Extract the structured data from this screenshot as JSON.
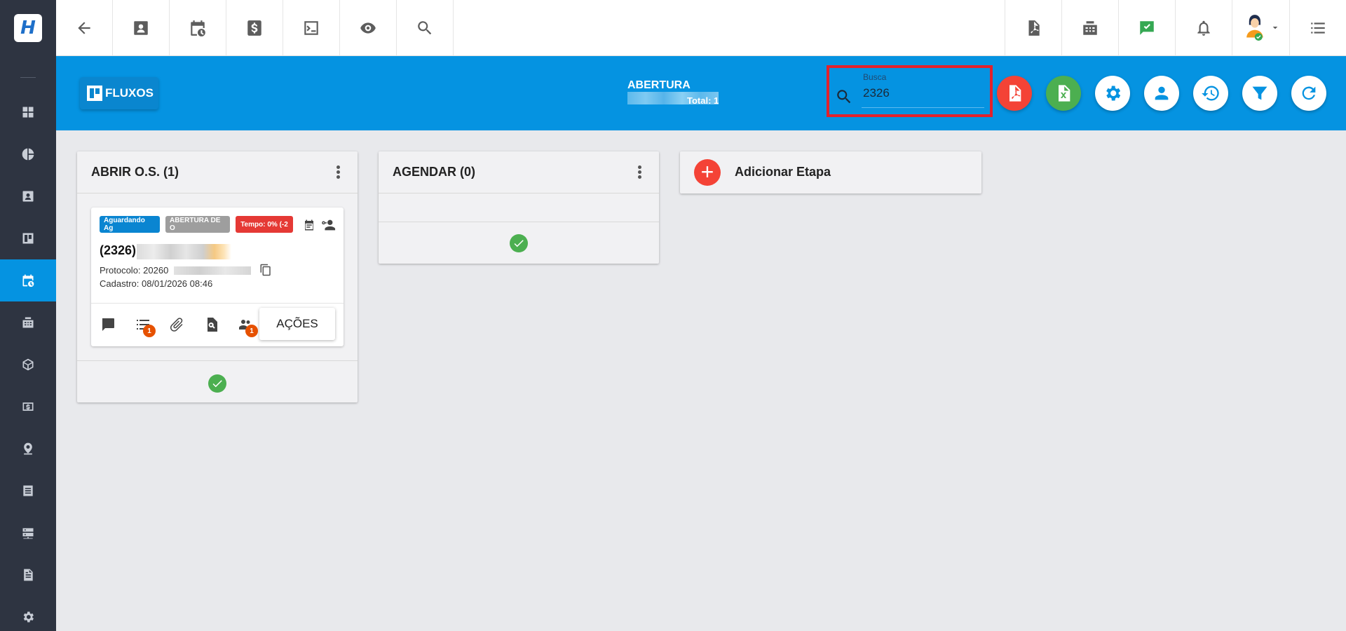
{
  "header": {
    "fluxos_label": "FLUXOS",
    "title": "ABERTURA",
    "total": "Total: 1",
    "search": {
      "label": "Busca",
      "value": "2326"
    }
  },
  "columns": [
    {
      "title": "ABRIR O.S. (1)",
      "card": {
        "tags": [
          "Aguardando Ag",
          "ABERTURA DE O",
          "Tempo: 0% (-2"
        ],
        "title": "(2326)",
        "protocol": "Protocolo: 20260",
        "created": "Cadastro: 08/01/2026 08:46",
        "checklist_badge": "1",
        "people_badge": "1",
        "actions_label": "AÇÕES"
      }
    },
    {
      "title": "AGENDAR (0)"
    }
  ],
  "add_stage_label": "Adicionar Etapa",
  "colors": {
    "sidebar": "#2e3441",
    "accent_blue": "#0593e1",
    "tag_blue": "#0a85d1",
    "tag_gray": "#9e9e9e",
    "tag_red": "#e53935",
    "pdf_red": "#f44336",
    "excel_green": "#4caf50"
  }
}
